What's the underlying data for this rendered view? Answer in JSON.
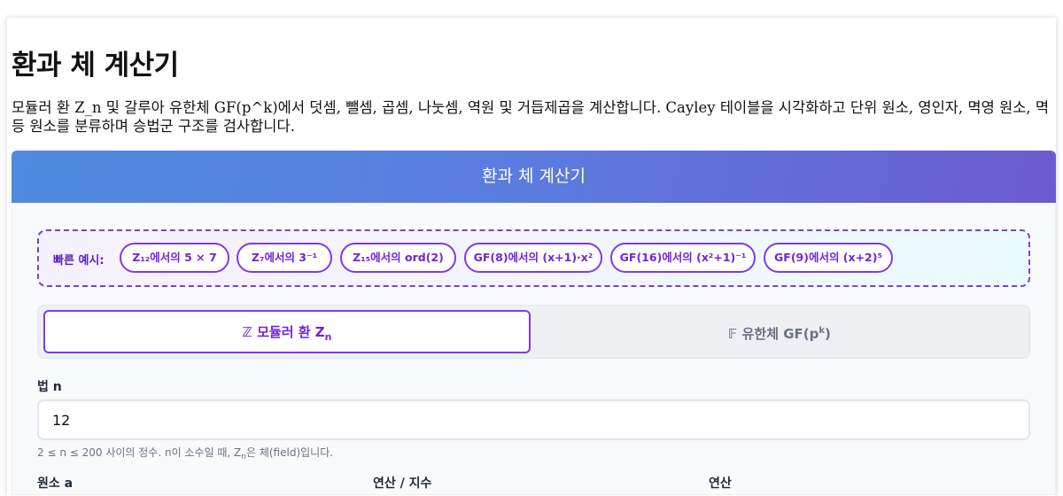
{
  "page": {
    "title": "환과 체 계산기",
    "description": "모듈러 환 Z_n 및 갈루아 유한체 GF(p^k)에서 덧셈, 뺄셈, 곱셈, 나눗셈, 역원 및 거듭제곱을 계산합니다. Cayley 테이블을 시각화하고 단위 원소, 영인자, 멱영 원소, 멱등 원소를 분류하며 승법군 구조를 검사합니다."
  },
  "calculator": {
    "header": "환과 체 계산기",
    "examples": {
      "label": "빠른 예시:",
      "items": [
        {
          "label": "Z₁₂에서의 5 × 7"
        },
        {
          "label": "Z₇에서의 3⁻¹"
        },
        {
          "label": "Z₁₅에서의 ord(2)"
        },
        {
          "label": "GF(8)에서의 (x+1)·x²"
        },
        {
          "label": "GF(16)에서의 (x²+1)⁻¹"
        },
        {
          "label": "GF(9)에서의 (x+2)⁵"
        }
      ]
    },
    "tabs": {
      "ring": {
        "icon": "ℤ",
        "label": "모듈러 환 Z",
        "sub": "n",
        "active": true
      },
      "field": {
        "icon": "𝔽",
        "label": "유한체 GF(p",
        "sup": "k",
        "suffix": ")",
        "active": false
      }
    },
    "modulus": {
      "label": "법 n",
      "value": "12",
      "hint_prefix": "2 ≤ n ≤ 200 사이의 정수. n이 소수일 때, Z",
      "hint_sub": "n",
      "hint_suffix": "은 체(field)입니다."
    },
    "next_fields": [
      "원소 a",
      "연산 / 지수",
      "연산"
    ]
  },
  "colors": {
    "accent": "#7c3aed",
    "header_gradient_start": "#4f8be0",
    "header_gradient_end": "#6c5bd0"
  }
}
